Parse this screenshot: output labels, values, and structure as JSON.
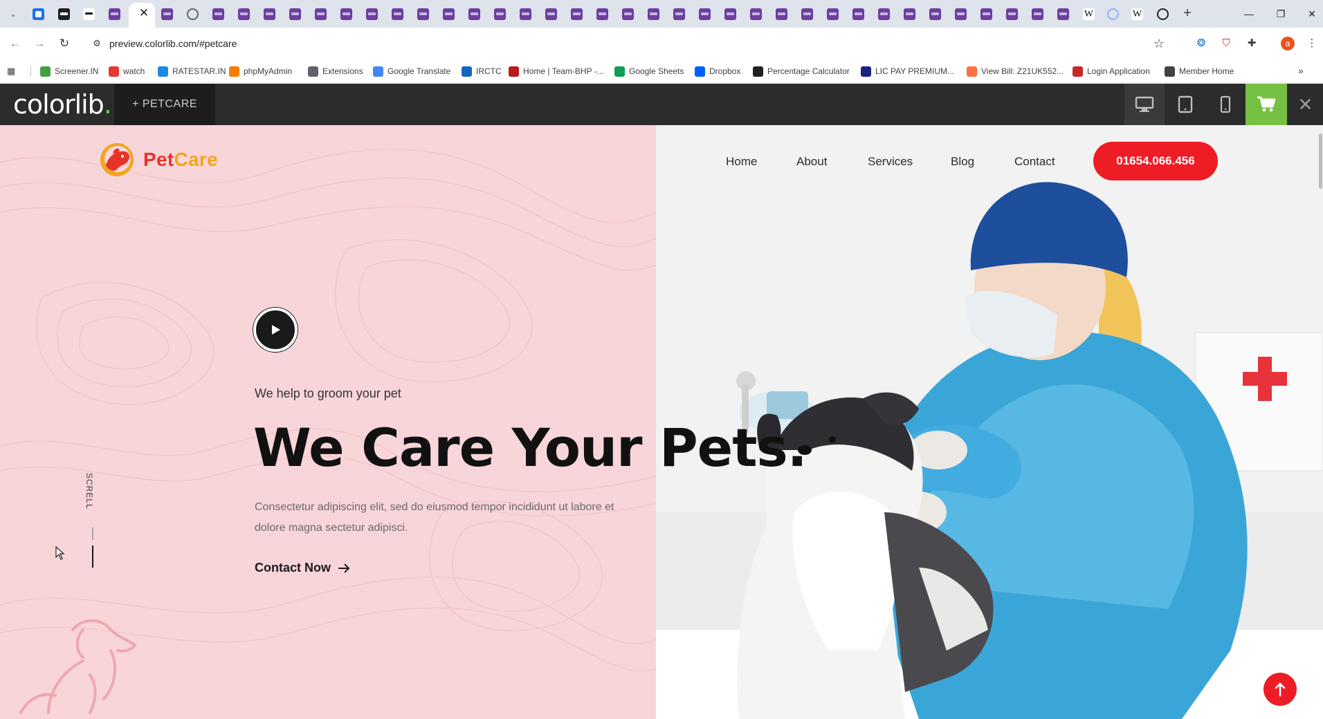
{
  "browser": {
    "url": "preview.colorlib.com/#petcare",
    "tab_close_glyph": "✕",
    "new_tab_glyph": "+",
    "profile_initial": "a",
    "bookmarks": [
      {
        "label": "Screener.IN",
        "color": "#43a047"
      },
      {
        "label": "watch",
        "color": "#e53935"
      },
      {
        "label": "RATESTAR.IN",
        "color": "#1e88e5"
      },
      {
        "label": "phpMyAdmin",
        "color": "#f57c00"
      },
      {
        "label": "Extensions",
        "color": "#5f6368"
      },
      {
        "label": "Google Translate",
        "color": "#4285f4"
      },
      {
        "label": "IRCTC",
        "color": "#1565c0"
      },
      {
        "label": "Home | Team-BHP -...",
        "color": "#b71c1c"
      },
      {
        "label": "Google Sheets",
        "color": "#0f9d58"
      },
      {
        "label": "Dropbox",
        "color": "#0061ff"
      },
      {
        "label": "Percentage Calculator",
        "color": "#212121"
      },
      {
        "label": "LIC PAY PREMIUM...",
        "color": "#1a237e"
      },
      {
        "label": "View Bill: Z21UK552...",
        "color": "#ff7043"
      },
      {
        "label": "Login Application",
        "color": "#c62828"
      },
      {
        "label": "Member Home",
        "color": "#424242"
      }
    ]
  },
  "colorlib": {
    "logo_text": "colorlib",
    "logo_dot": ".",
    "theme_label": "+   PETCARE"
  },
  "site": {
    "brand": {
      "part1": "Pet",
      "part2": "Care"
    },
    "nav": [
      "Home",
      "About",
      "Services",
      "Blog",
      "Contact"
    ],
    "phone": "01654.066.456",
    "hero": {
      "subtitle": "We help to groom your pet",
      "headline": "We Care Your Pets.",
      "lead": "Consectetur adipiscing elit, sed do eiusmod tempor incididunt ut labore et dolore magna sectetur adipisci.",
      "cta": "Contact Now",
      "scroll_label": "SCRELL"
    }
  },
  "colors": {
    "pink_bg": "#f8d5d8",
    "brand_red": "#ee1c25",
    "brand_orange": "#f2a51d",
    "cart_green": "#76c043",
    "colorlib_bar": "#2c2c2c"
  },
  "icons": {
    "back": "arrow-left-icon",
    "forward": "arrow-right-icon",
    "reload": "reload-icon",
    "bookmark": "star-icon",
    "cart": "cart-icon",
    "close": "close-icon",
    "play": "play-icon",
    "scroll_top": "arrow-up-icon"
  }
}
